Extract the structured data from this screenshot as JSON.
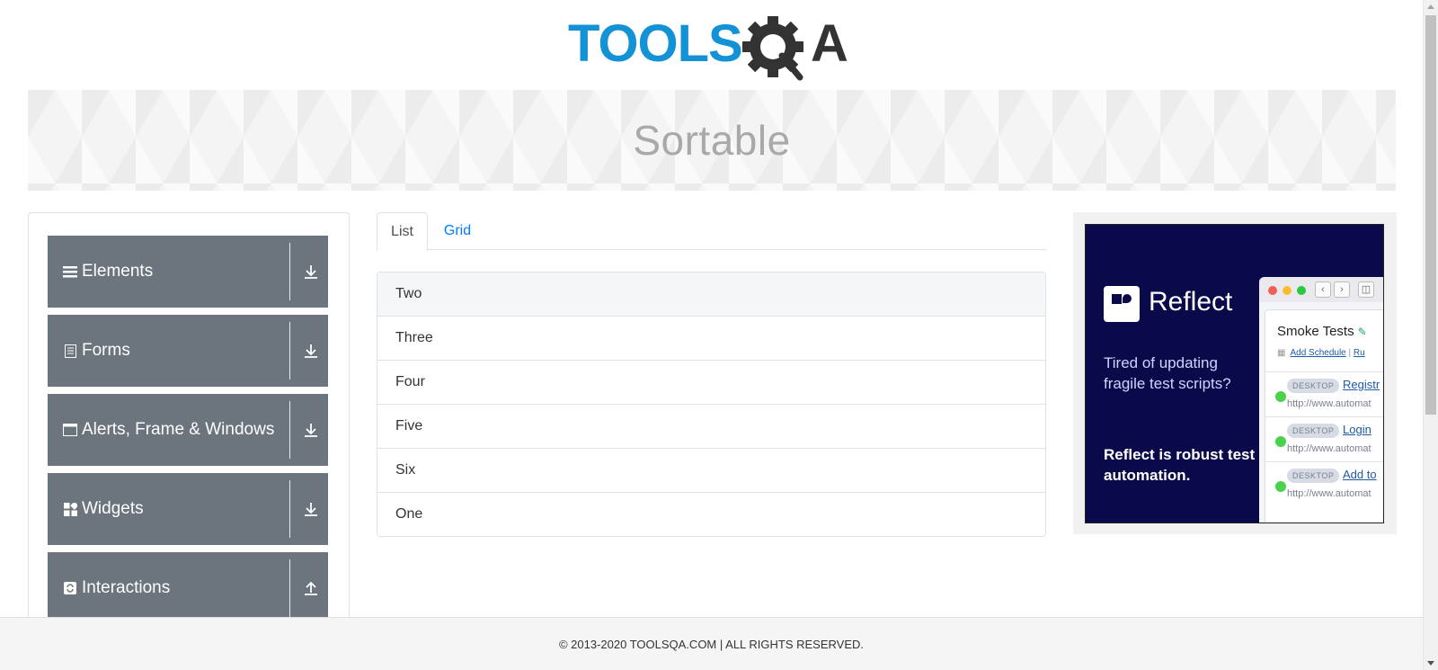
{
  "header": {
    "logo_text_blue": "TOOLS",
    "logo_text_dark": "A",
    "logo_alt": "TOOLSQA"
  },
  "banner": {
    "title": "Sortable"
  },
  "sidebar": {
    "groups": [
      {
        "label": "Elements",
        "icon": "hamburger-icon",
        "arrow": "download-icon"
      },
      {
        "label": "Forms",
        "icon": "document-icon",
        "arrow": "download-icon"
      },
      {
        "label": "Alerts, Frame & Windows",
        "icon": "window-icon",
        "arrow": "download-icon"
      },
      {
        "label": "Widgets",
        "icon": "widgets-icon",
        "arrow": "download-icon"
      },
      {
        "label": "Interactions",
        "icon": "refresh-icon",
        "arrow": "upload-icon"
      }
    ]
  },
  "tabs": {
    "list": "List",
    "grid": "Grid",
    "active": "List"
  },
  "list_items": [
    "Two",
    "Three",
    "Four",
    "Five",
    "Six",
    "One"
  ],
  "ad": {
    "brand": "Reflect",
    "text1": "Tired of updating fragile test scripts?",
    "text2": "Reflect is robust test automation.",
    "panel_title": "Smoke Tests",
    "panel_link1": "Add Schedule",
    "panel_sep": "|",
    "panel_link2": "Ru",
    "rows": [
      {
        "tag": "DESKTOP",
        "link": "Registr",
        "url": "http://www.automat"
      },
      {
        "tag": "DESKTOP",
        "link": "Login",
        "url": "http://www.automat"
      },
      {
        "tag": "DESKTOP",
        "link": "Add to",
        "url": "http://www.automat"
      }
    ]
  },
  "footer": {
    "text": "© 2013-2020 TOOLSQA.COM | ALL RIGHTS RESERVED."
  },
  "colors": {
    "brand_blue": "#1492d6",
    "sidebar_group": "#6c757d",
    "link": "#007bff",
    "ad_bg": "#0a0a4a"
  }
}
